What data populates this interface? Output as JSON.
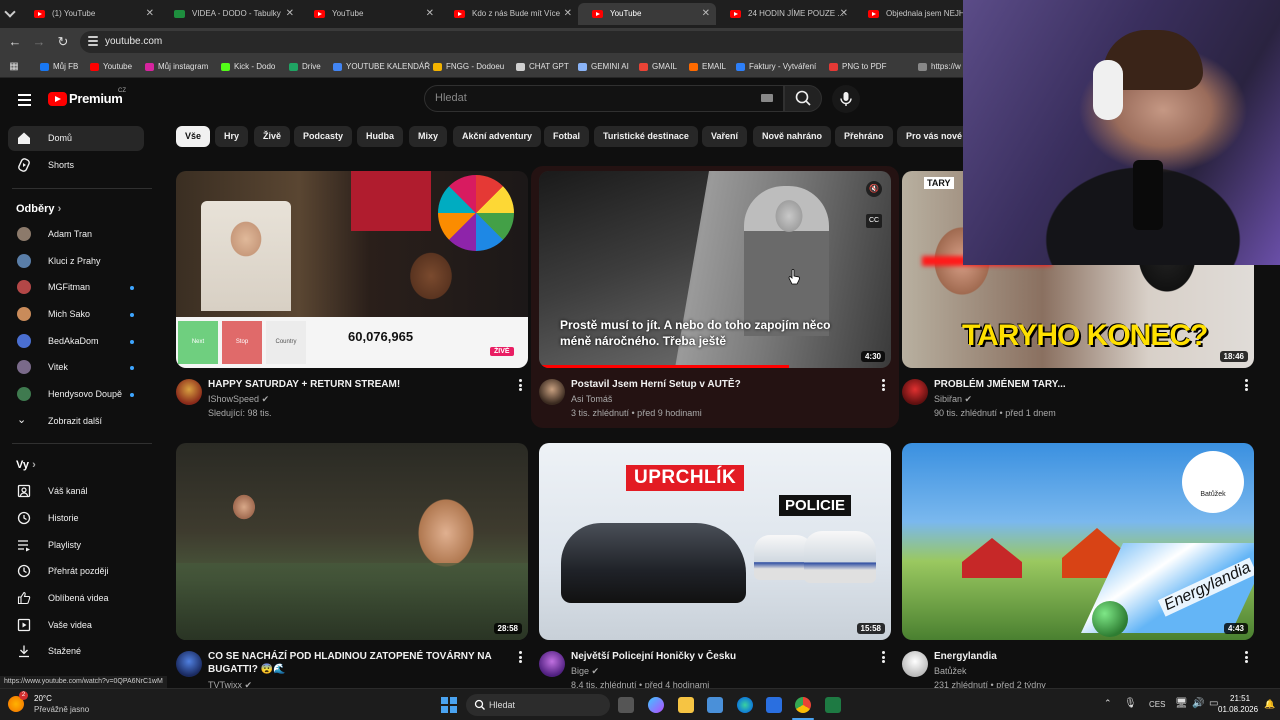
{
  "browser": {
    "tabs": [
      {
        "title": "(1) YouTube",
        "active": false
      },
      {
        "title": "VIDEA - DODO - Tabulky",
        "active": false
      },
      {
        "title": "YouTube",
        "active": false
      },
      {
        "title": "Kdo z nás Bude mít Více",
        "active": false
      },
      {
        "title": "YouTube",
        "active": true
      },
      {
        "title": "24 HODIN JÍME POUZE ...",
        "active": false
      },
      {
        "title": "Objednala jsem NEJHO",
        "active": false
      }
    ],
    "url": "youtube.com",
    "bookmarks": [
      {
        "label": "Můj FB",
        "color": "#1877f2"
      },
      {
        "label": "Youtube",
        "color": "#ff0000"
      },
      {
        "label": "Můj instagram",
        "color": "#d6249f"
      },
      {
        "label": "Kick - Dodo",
        "color": "#53fc18"
      },
      {
        "label": "Drive",
        "color": "#1fa463"
      },
      {
        "label": "YOUTUBE KALENDÁŘ",
        "color": "#4285f4"
      },
      {
        "label": "FNGG - Dodoeu",
        "color": "#f4b400"
      },
      {
        "label": "CHAT GPT",
        "color": "#cfcfcf"
      },
      {
        "label": "GEMINI AI",
        "color": "#8ab4f8"
      },
      {
        "label": "GMAIL",
        "color": "#ea4335"
      },
      {
        "label": "EMAIL",
        "color": "#ff6a00"
      },
      {
        "label": "Faktury - Vytváření",
        "color": "#2d7ff9"
      },
      {
        "label": "PNG to PDF",
        "color": "#e53935"
      },
      {
        "label": "https://w",
        "color": "#888888"
      }
    ]
  },
  "youtube": {
    "logo_text": "Premium",
    "logo_region": "CZ",
    "search_placeholder": "Hledat",
    "sidebar": {
      "main": [
        {
          "label": "Domů",
          "active": true,
          "icon": "home-icon"
        },
        {
          "label": "Shorts",
          "active": false,
          "icon": "shorts-icon"
        }
      ],
      "subscriptions_heading": "Odběry",
      "subscriptions": [
        {
          "label": "Adam Tran",
          "color": "#8c7a6b",
          "new": false
        },
        {
          "label": "Kluci z Prahy",
          "color": "#5a7ea8",
          "new": false
        },
        {
          "label": "MGFitman",
          "color": "#b34747",
          "new": true
        },
        {
          "label": "Mich Sako",
          "color": "#c98b5a",
          "new": true
        },
        {
          "label": "BedAkaDom",
          "color": "#4a6fd1",
          "new": true
        },
        {
          "label": "Vitek",
          "color": "#7a6a8a",
          "new": true
        },
        {
          "label": "Hendysovo Doupě",
          "color": "#3f7a4f",
          "new": true
        }
      ],
      "show_more": "Zobrazit další",
      "you_heading": "Vy",
      "you": [
        {
          "label": "Váš kanál",
          "icon": "channel-icon"
        },
        {
          "label": "Historie",
          "icon": "history-icon"
        },
        {
          "label": "Playlisty",
          "icon": "playlists-icon"
        },
        {
          "label": "Přehrát později",
          "icon": "watch-later-icon"
        },
        {
          "label": "Oblíbená videa",
          "icon": "like-icon"
        },
        {
          "label": "Vaše videa",
          "icon": "your-videos-icon"
        },
        {
          "label": "Stažené",
          "icon": "download-icon"
        }
      ]
    },
    "chips": [
      "Vše",
      "Hry",
      "Živě",
      "Podcasty",
      "Hudba",
      "Mixy",
      "Akční adventury",
      "Fotbal",
      "Turistické destinace",
      "Vaření",
      "Nově nahráno",
      "Přehráno",
      "Pro vás nové"
    ],
    "videos": [
      {
        "title": "HAPPY SATURDAY + RETURN STREAM!",
        "channel": "IShowSpeed",
        "verified": true,
        "meta": "Sledující: 98 tis.",
        "duration": "",
        "live_badge": "ŽIVĚ",
        "overlay_counter": "60,076,965",
        "wheel_labels": [
          "Next",
          "Stop",
          "Country"
        ]
      },
      {
        "title": "Postavil Jsem Herní Setup v AUTĚ?",
        "channel": "Asi Tomáš",
        "verified": false,
        "meta": "3 tis. zhlédnutí • před 9 hodinami",
        "duration": "4:30",
        "subtitle": "Prostě musí to jít. A nebo do toho zapojím něco méně náročného. Třeba ještě"
      },
      {
        "title": "PROBLÉM JMÉNEM TARY...",
        "channel": "Sibiřan",
        "verified": true,
        "meta": "90 tis. zhlédnutí • před 1 dnem",
        "duration": "18:46",
        "thumb_text": "TARYHO KONEC?",
        "corner_text": "TARY"
      },
      {
        "title": "CO SE NACHÁZÍ POD HLADINOU ZATOPENÉ TOVÁRNY NA BUGATTI? 😨🌊",
        "channel": "TVTwixx",
        "verified": true,
        "meta": "",
        "duration": "28:58"
      },
      {
        "title": "Největší Policejní Honičky v Česku",
        "channel": "Bige",
        "verified": true,
        "meta": "8,4 tis. zhlédnutí • před 4 hodinami",
        "duration": "15:58",
        "thumb_text": "UPRCHLÍK",
        "thumb_text2": "POLICIE"
      },
      {
        "title": "Energylandia",
        "channel": "Batůžek",
        "verified": false,
        "meta": "231 zhlédnutí • před 2 týdny",
        "duration": "4:43",
        "thumb_text": "Energylandia",
        "corner_text": "Batůžek"
      }
    ]
  },
  "status_url": "https://www.youtube.com/watch?v=0QPA6NrC1wM",
  "taskbar": {
    "weather_temp": "20°C",
    "weather_desc": "Převážně jasno",
    "weather_badge": "2",
    "search_placeholder": "Hledat",
    "lang": "CES",
    "time": "21:51",
    "date": "01.08.2026"
  }
}
